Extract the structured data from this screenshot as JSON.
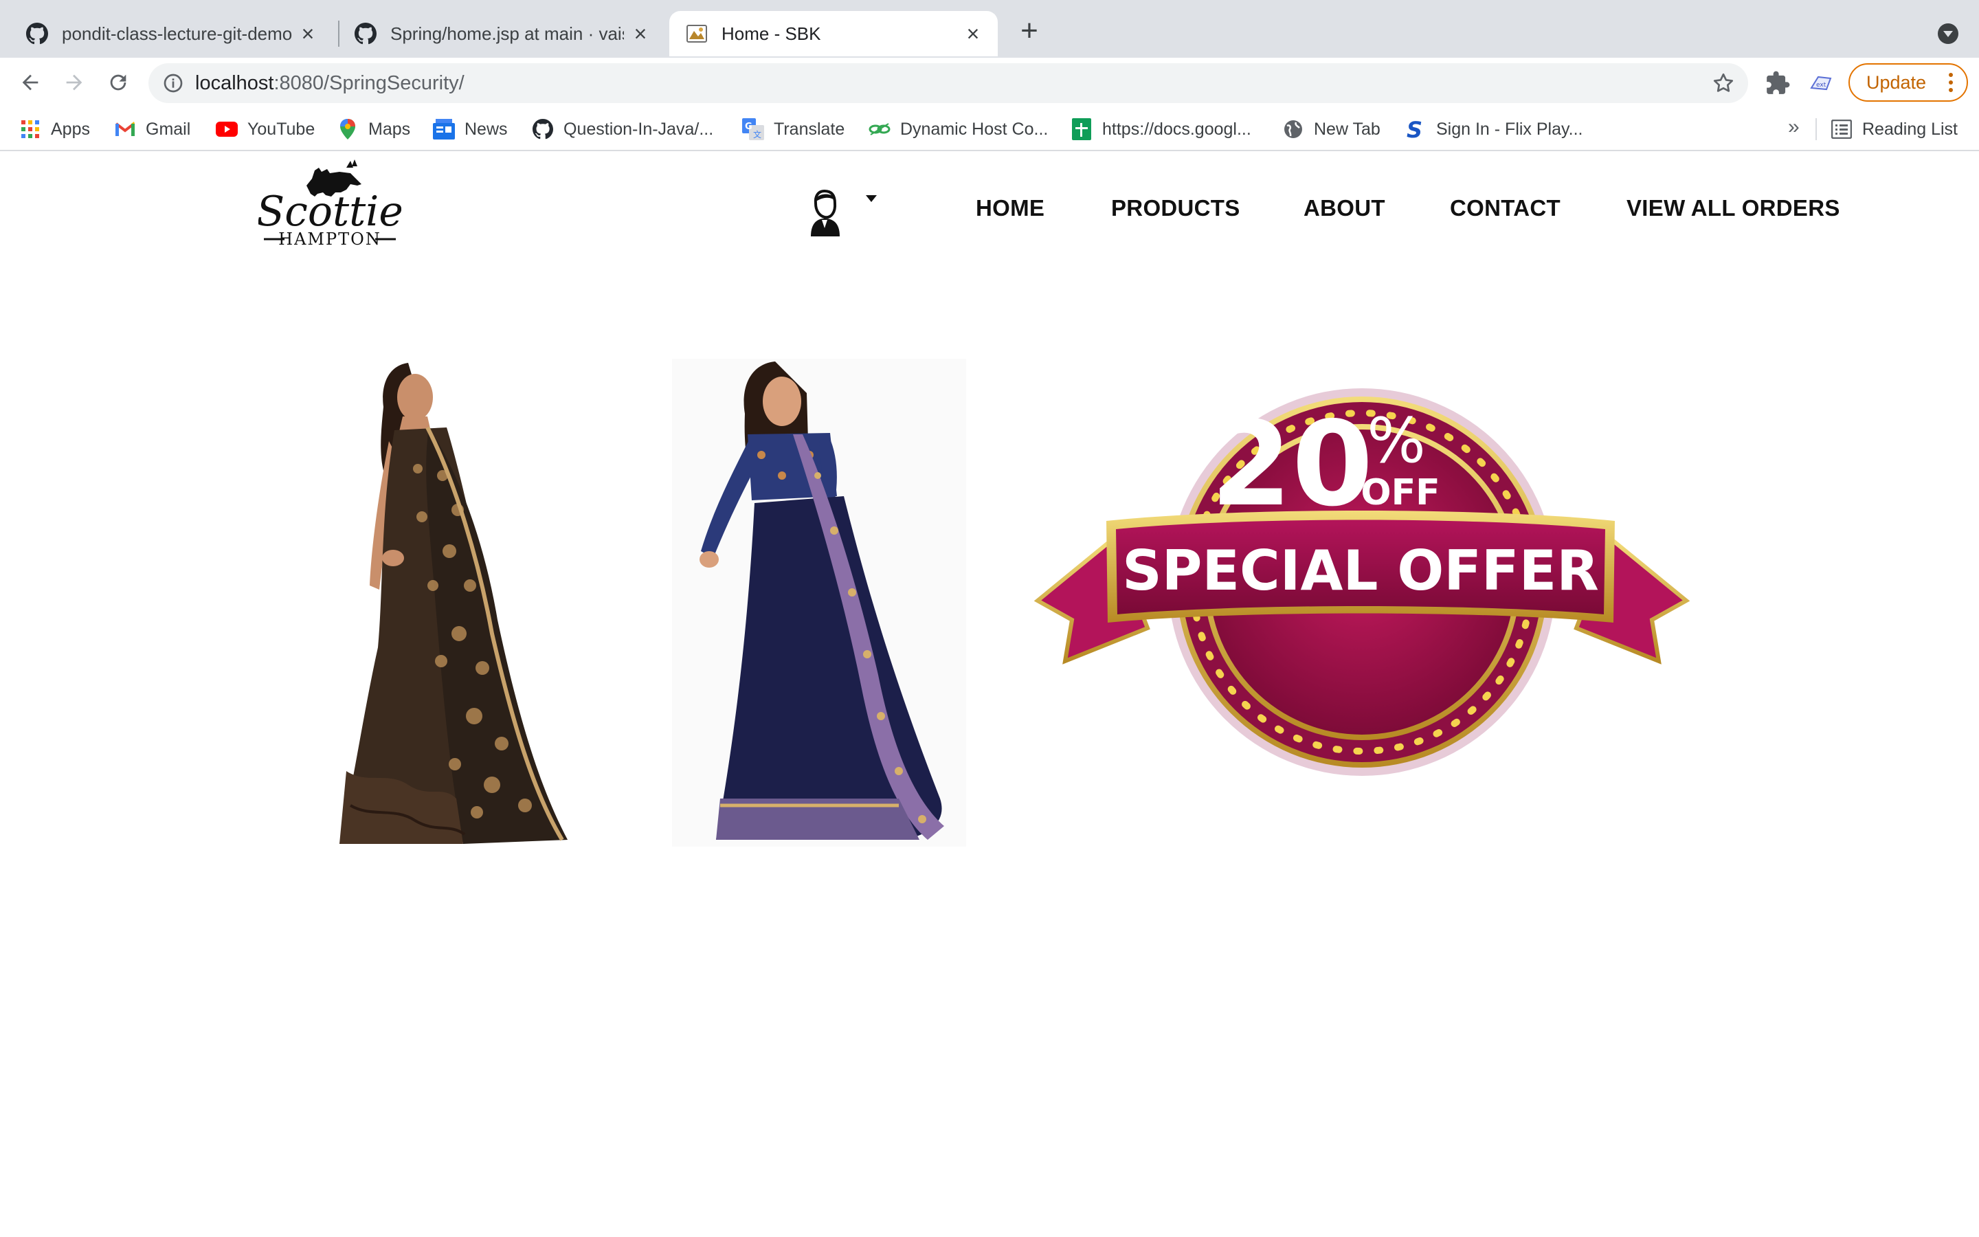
{
  "browser": {
    "tabs": [
      {
        "title": "pondit-class-lecture-git-demo",
        "icon": "github-icon"
      },
      {
        "title": "Spring/home.jsp at main · vaish",
        "icon": "github-icon"
      },
      {
        "title": "Home - SBK",
        "icon": "site-favicon",
        "active": true
      }
    ],
    "url_host": "localhost",
    "url_rest": ":8080/SpringSecurity/",
    "update_label": "Update",
    "bookmarks": [
      {
        "label": "Apps",
        "icon": "apps-grid-icon"
      },
      {
        "label": "Gmail",
        "icon": "gmail-icon"
      },
      {
        "label": "YouTube",
        "icon": "youtube-icon"
      },
      {
        "label": "Maps",
        "icon": "maps-pin-icon"
      },
      {
        "label": "News",
        "icon": "google-news-icon"
      },
      {
        "label": "Question-In-Java/...",
        "icon": "github-icon"
      },
      {
        "label": "Translate",
        "icon": "translate-icon"
      },
      {
        "label": "Dynamic Host Co...",
        "icon": "link-chain-icon"
      },
      {
        "label": "https://docs.googl...",
        "icon": "google-sheets-icon"
      },
      {
        "label": "New Tab",
        "icon": "globe-icon"
      },
      {
        "label": "Sign In - Flix Play...",
        "icon": "s-logo-icon"
      }
    ],
    "bookmarks_overflow": "»",
    "reading_list": "Reading List"
  },
  "site": {
    "logo_line1": "Scottie",
    "logo_line2": "HAMPTON",
    "nav": [
      "HOME",
      "PRODUCTS",
      "ABOUT",
      "CONTACT",
      "VIEW ALL ORDERS"
    ],
    "offer": {
      "percent": "20",
      "percent_sign": "%",
      "off": "OFF",
      "banner": "SPECIAL OFFER"
    }
  },
  "colors": {
    "tabstrip": "#dee1e6",
    "omnibox": "#f1f3f4",
    "update": "#e37400",
    "offer_crimson": "#a3104a",
    "offer_gold": "#d8b032",
    "saree_brown": "#3a2a1e",
    "saree_navy": "#1c1f4a"
  }
}
